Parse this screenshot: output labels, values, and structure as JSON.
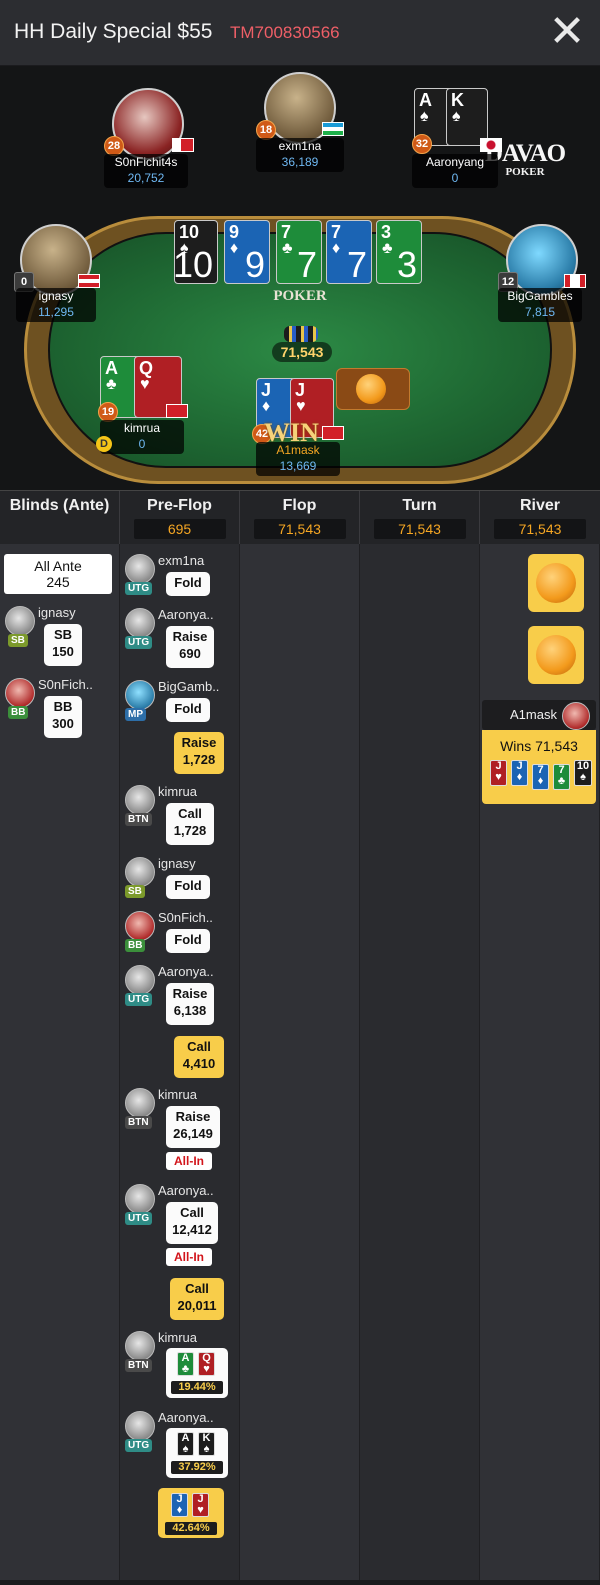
{
  "header": {
    "title": "HH Daily Special $55",
    "tournament_id": "TM700830566",
    "close_icon": "close-icon"
  },
  "logo": {
    "main": "DAVAO",
    "sub": "POKER"
  },
  "table": {
    "felt_label": "POKER",
    "pot": "71,543",
    "win_label": "WIN",
    "board": [
      {
        "rank": "10",
        "suit": "♠",
        "color": "black"
      },
      {
        "rank": "9",
        "suit": "♦",
        "color": "blue"
      },
      {
        "rank": "7",
        "suit": "♣",
        "color": "green"
      },
      {
        "rank": "7",
        "suit": "♦",
        "color": "blue"
      },
      {
        "rank": "3",
        "suit": "♣",
        "color": "green"
      }
    ],
    "seats": [
      {
        "name": "S0nFichit4s",
        "stack": "20,752",
        "level": "28"
      },
      {
        "name": "exm1na",
        "stack": "36,189",
        "level": "18"
      },
      {
        "name": "Aaronyang",
        "stack": "0",
        "level": "32",
        "cards": [
          {
            "rank": "A",
            "suit": "♠"
          },
          {
            "rank": "K",
            "suit": "♠"
          }
        ]
      },
      {
        "name": "ignasy",
        "stack": "11,295",
        "level": "0"
      },
      {
        "name": "BigGambles",
        "stack": "7,815",
        "level": "12"
      },
      {
        "name": "kimrua",
        "stack": "0",
        "level": "19",
        "cards": [
          {
            "rank": "A",
            "suit": "♣"
          },
          {
            "rank": "Q",
            "suit": "♥"
          }
        ]
      },
      {
        "name": "A1mask",
        "stack": "13,669",
        "level": "42",
        "cards": [
          {
            "rank": "J",
            "suit": "♦"
          },
          {
            "rank": "J",
            "suit": "♥"
          }
        ]
      }
    ],
    "dealer_button": "D"
  },
  "columns": [
    {
      "title": "Blinds (Ante)",
      "value": ""
    },
    {
      "title": "Pre-Flop",
      "value": "695"
    },
    {
      "title": "Flop",
      "value": "71,543"
    },
    {
      "title": "Turn",
      "value": "71,543"
    },
    {
      "title": "River",
      "value": "71,543"
    }
  ],
  "blinds": {
    "all_ante_label": "All Ante",
    "all_ante_value": "245",
    "rows": [
      {
        "name": "ignasy",
        "pos": "SB",
        "action": "SB",
        "amount": "150"
      },
      {
        "name": "S0nFich..",
        "pos": "BB",
        "action": "BB",
        "amount": "300"
      }
    ]
  },
  "preflop": [
    {
      "name": "exm1na",
      "pos": "UTG",
      "action": "Fold"
    },
    {
      "name": "Aaronya..",
      "pos": "UTG",
      "action": "Raise",
      "amount": "690"
    },
    {
      "name": "BigGamb..",
      "pos": "MP",
      "action": "Fold"
    },
    {
      "pot_action": "Raise",
      "pot_amount": "1,728"
    },
    {
      "name": "kimrua",
      "pos": "BTN",
      "action": "Call",
      "amount": "1,728"
    },
    {
      "name": "ignasy",
      "pos": "SB",
      "action": "Fold"
    },
    {
      "name": "S0nFich..",
      "pos": "BB",
      "action": "Fold"
    },
    {
      "name": "Aaronya..",
      "pos": "UTG",
      "action": "Raise",
      "amount": "6,138"
    },
    {
      "pot_action": "Call",
      "pot_amount": "4,410"
    },
    {
      "name": "kimrua",
      "pos": "BTN",
      "action": "Raise",
      "amount": "26,149",
      "tag": "All-In"
    },
    {
      "name": "Aaronya..",
      "pos": "UTG",
      "action": "Call",
      "amount": "12,412",
      "tag": "All-In"
    },
    {
      "pot_action": "Call",
      "pot_amount": "20,011"
    },
    {
      "name": "kimrua",
      "pos": "BTN",
      "show": [
        {
          "rank": "A",
          "suit": "♣"
        },
        {
          "rank": "Q",
          "suit": "♥"
        }
      ],
      "equity": "19.44%"
    },
    {
      "name": "Aaronya..",
      "pos": "UTG",
      "show": [
        {
          "rank": "A",
          "suit": "♠"
        },
        {
          "rank": "K",
          "suit": "♠"
        }
      ],
      "equity": "37.92%"
    },
    {
      "show": [
        {
          "rank": "J",
          "suit": "♦"
        },
        {
          "rank": "J",
          "suit": "♥"
        }
      ],
      "equity": "42.64%"
    }
  ],
  "river": {
    "winner_name": "A1mask",
    "wins_label": "Wins 71,543",
    "winning_hand": [
      {
        "rank": "J",
        "suit": "♥"
      },
      {
        "rank": "J",
        "suit": "♦"
      },
      {
        "rank": "7",
        "suit": "♦"
      },
      {
        "rank": "7",
        "suit": "♣"
      },
      {
        "rank": "10",
        "suit": "♠"
      }
    ]
  }
}
